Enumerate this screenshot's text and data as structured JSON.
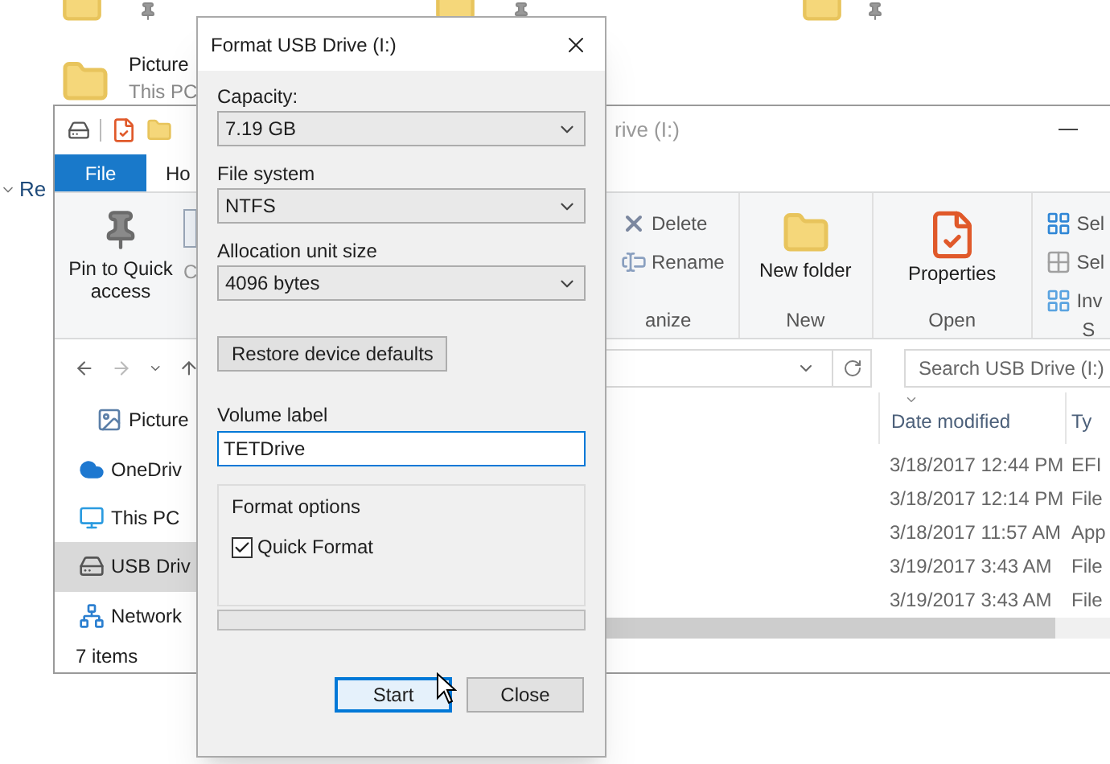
{
  "desktop": {
    "item": {
      "name": "Picture",
      "location": "This PC"
    },
    "section": "Re"
  },
  "explorer": {
    "title": "rive (I:)",
    "tabs": [
      {
        "label": "File",
        "selected": true
      },
      {
        "label": "Ho",
        "selected": false
      }
    ],
    "ribbon_left": [
      {
        "label": "Pin to Quick access",
        "kind": "pin"
      },
      {
        "label": "C",
        "kind": "copy"
      }
    ],
    "groups": [
      {
        "label": "anize",
        "buttons": [
          {
            "label": "Delete",
            "kind": "delete"
          },
          {
            "label": "Rename",
            "kind": "rename"
          }
        ]
      },
      {
        "label": "New",
        "buttons": [
          {
            "label": "New folder",
            "kind": "folder"
          }
        ]
      },
      {
        "label": "Open",
        "buttons": [
          {
            "label": "Properties",
            "kind": "properties"
          }
        ]
      },
      {
        "label": "S",
        "buttons": [
          {
            "label": "Sel",
            "kind": "select-all"
          },
          {
            "label": "Sel",
            "kind": "select-none"
          },
          {
            "label": "Inv",
            "kind": "invert"
          }
        ]
      }
    ],
    "search": {
      "placeholder": "Search USB Drive (I:)"
    },
    "nav": [
      {
        "label": "Picture",
        "kind": "pictures",
        "selected": false
      },
      {
        "label": "OneDriv",
        "kind": "cloud",
        "selected": false
      },
      {
        "label": "This PC",
        "kind": "pc",
        "selected": false
      },
      {
        "label": "USB Driv",
        "kind": "drive",
        "selected": true
      },
      {
        "label": "Network",
        "kind": "network",
        "selected": false
      }
    ],
    "columns": [
      "Date modified",
      "Ty"
    ],
    "rows": [
      [
        "3/18/2017 12:44 PM",
        "EFI"
      ],
      [
        "3/18/2017 12:14 PM",
        "File"
      ],
      [
        "3/18/2017 11:57 AM",
        "App"
      ],
      [
        "3/19/2017 3:43 AM",
        "File"
      ],
      [
        "3/19/2017 3:43 AM",
        "File"
      ]
    ],
    "status": "7 items"
  },
  "dialog": {
    "title": "Format USB Drive (I:)",
    "fields": [
      {
        "label": "Capacity:",
        "value": "7.19 GB"
      },
      {
        "label": "File system",
        "value": "NTFS"
      },
      {
        "label": "Allocation unit size",
        "value": "4096 bytes"
      }
    ],
    "restore_button": "Restore device defaults",
    "volume_label": {
      "label": "Volume label",
      "value": "TETDrive"
    },
    "format_options": {
      "title": "Format options",
      "options": [
        {
          "label": "Quick Format",
          "checked": true
        }
      ]
    },
    "progress": {
      "level": 0
    },
    "buttons": [
      {
        "label": "Start",
        "focused": true
      },
      {
        "label": "Close",
        "focused": false
      }
    ]
  }
}
